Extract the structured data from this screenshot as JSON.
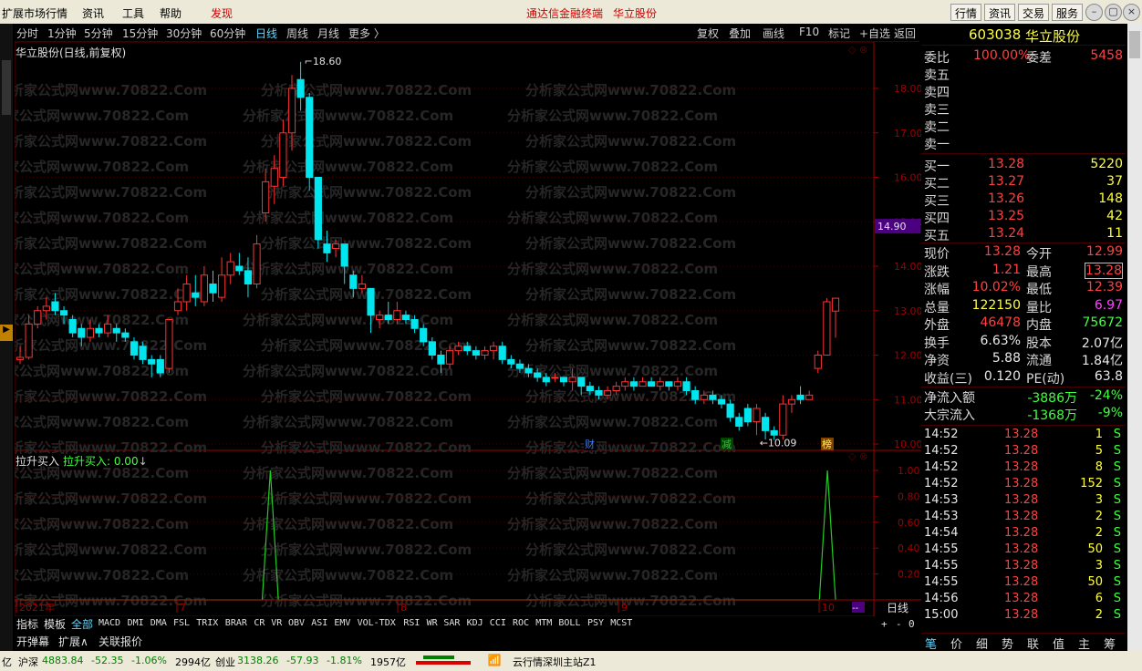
{
  "menubar": {
    "items": [
      "扩展市场行情",
      "资讯",
      "工具",
      "帮助"
    ],
    "discover": "发现",
    "center_title": "通达信金融终端",
    "center_stock": "华立股份",
    "sys_buttons": [
      "行情",
      "资讯",
      "交易",
      "服务"
    ],
    "win_buttons": [
      "–",
      "▢",
      "×"
    ]
  },
  "toolbar": {
    "left": [
      "分时",
      "1分钟",
      "5分钟",
      "15分钟",
      "30分钟",
      "60分钟",
      "日线",
      "周线",
      "月线",
      "更多 〉"
    ],
    "active": "日线",
    "right": [
      "复权",
      "叠加",
      "画线",
      "F10",
      "标记",
      "+自选",
      "返回"
    ]
  },
  "chart": {
    "title": "华立股份(日线,前复权)",
    "max_label": "18.60",
    "min_label": "10.09",
    "current_price_tag": "14.90",
    "y_labels": [
      "18.00",
      "17.00",
      "16.00",
      "15.00",
      "14.00",
      "13.00",
      "12.00",
      "11.00",
      "10.00"
    ],
    "events": [
      {
        "label": "财",
        "color": "#3a7dff",
        "bg": "#000000"
      },
      {
        "label": "减",
        "color": "#40c040",
        "bg": "#004000"
      },
      {
        "label": "榜",
        "color": "#ffff40",
        "bg": "#804000"
      }
    ],
    "date_labels": [
      "2021年",
      "7",
      "8",
      "9",
      "10"
    ],
    "period_label": "日线",
    "watermark": "分析家公式网www.70822.Com"
  },
  "indicator": {
    "name": "拉升买入",
    "value_label": "拉升买入: 0.00",
    "arrow": "↓",
    "y_labels": [
      "1.00",
      "0.80",
      "0.60",
      "0.40",
      "0.20"
    ]
  },
  "chart_data": [
    {
      "type": "candlestick",
      "title": "华立股份(日线,前复权)",
      "ylim": [
        10.0,
        18.6
      ],
      "max": 18.6,
      "min": 10.09
    },
    {
      "type": "line",
      "title": "拉升买入",
      "series": [
        {
          "name": "拉升买入",
          "values": [
            0,
            0,
            0,
            0,
            0,
            0,
            0,
            0,
            0,
            0,
            0,
            0,
            0,
            0,
            0,
            0,
            0,
            0,
            0,
            0,
            0,
            0,
            0,
            0,
            0,
            0,
            0,
            0,
            0,
            0,
            0,
            1,
            0,
            0,
            0,
            0,
            0,
            0,
            0,
            0,
            0,
            0,
            0,
            0,
            0,
            0,
            0,
            0,
            0,
            0,
            0,
            0,
            0,
            0,
            0,
            0,
            0,
            0,
            0,
            0,
            0,
            0,
            0,
            0,
            0,
            0,
            0,
            0,
            0,
            0,
            0,
            0,
            0,
            0,
            0,
            0,
            0,
            0,
            0,
            0,
            0,
            0,
            0,
            0,
            0,
            0,
            0,
            0,
            0,
            0,
            0,
            0,
            0,
            0,
            0,
            0,
            0,
            0,
            0,
            0,
            1,
            0
          ]
        }
      ],
      "ylim": [
        0,
        1
      ]
    }
  ],
  "quote": {
    "code": "603038",
    "name": "华立股份",
    "weibi_label": "委比",
    "weibi": "100.00%",
    "weicha_label": "委差",
    "weicha": "5458",
    "sells": [
      {
        "label": "卖五"
      },
      {
        "label": "卖四"
      },
      {
        "label": "卖三"
      },
      {
        "label": "卖二"
      },
      {
        "label": "卖一"
      }
    ],
    "buys": [
      {
        "label": "买一",
        "price": "13.28",
        "vol": "5220"
      },
      {
        "label": "买二",
        "price": "13.27",
        "vol": "37"
      },
      {
        "label": "买三",
        "price": "13.26",
        "vol": "148"
      },
      {
        "label": "买四",
        "price": "13.25",
        "vol": "42"
      },
      {
        "label": "买五",
        "price": "13.24",
        "vol": "11"
      }
    ],
    "stats": [
      {
        "l1": "现价",
        "v1": "13.28",
        "c1": "pr",
        "l2": "今开",
        "v2": "12.99",
        "c2": "pr"
      },
      {
        "l1": "涨跌",
        "v1": "1.21",
        "c1": "pr",
        "l2": "最高",
        "v2": "13.28",
        "c2": "pr"
      },
      {
        "l1": "涨幅",
        "v1": "10.02%",
        "c1": "pr",
        "l2": "最低",
        "v2": "12.39",
        "c2": "pr"
      },
      {
        "l1": "总量",
        "v1": "122150",
        "c1": "yl",
        "l2": "量比",
        "v2": "6.97",
        "c2": "mg"
      },
      {
        "l1": "外盘",
        "v1": "46478",
        "c1": "pr",
        "l2": "内盘",
        "v2": "75672",
        "c2": "gn"
      },
      {
        "l1": "换手",
        "v1": "6.63%",
        "c1": "wt",
        "l2": "股本",
        "v2": "2.07亿",
        "c2": "wt"
      },
      {
        "l1": "净资",
        "v1": "5.88",
        "c1": "wt",
        "l2": "流通",
        "v2": "1.84亿",
        "c2": "wt"
      },
      {
        "l1": "收益(三)",
        "v1": "0.120",
        "c1": "wt",
        "l2": "PE(动)",
        "v2": "63.8",
        "c2": "wt"
      }
    ],
    "flow": [
      {
        "label": "净流入额",
        "val": "-3886万",
        "pct": "-24%"
      },
      {
        "label": "大宗流入",
        "val": "-1368万",
        "pct": "-9%"
      }
    ],
    "ticks": [
      {
        "t": "14:52",
        "p": "13.28",
        "v": "1",
        "s": "S"
      },
      {
        "t": "14:52",
        "p": "13.28",
        "v": "5",
        "s": "S"
      },
      {
        "t": "14:52",
        "p": "13.28",
        "v": "8",
        "s": "S"
      },
      {
        "t": "14:52",
        "p": "13.28",
        "v": "152",
        "s": "S"
      },
      {
        "t": "14:53",
        "p": "13.28",
        "v": "3",
        "s": "S"
      },
      {
        "t": "14:53",
        "p": "13.28",
        "v": "2",
        "s": "S"
      },
      {
        "t": "14:54",
        "p": "13.28",
        "v": "2",
        "s": "S"
      },
      {
        "t": "14:55",
        "p": "13.28",
        "v": "50",
        "s": "S"
      },
      {
        "t": "14:55",
        "p": "13.28",
        "v": "3",
        "s": "S"
      },
      {
        "t": "14:55",
        "p": "13.28",
        "v": "50",
        "s": "S"
      },
      {
        "t": "14:56",
        "p": "13.28",
        "v": "6",
        "s": "S"
      },
      {
        "t": "15:00",
        "p": "13.28",
        "v": "2",
        "s": "S"
      }
    ],
    "bottom_tabs": [
      "笔",
      "价",
      "细",
      "势",
      "联",
      "值",
      "主",
      "筹"
    ]
  },
  "tabs": {
    "items": [
      "指标",
      "模板",
      "全部",
      "MACD",
      "DMI",
      "DMA",
      "FSL",
      "TRIX",
      "BRAR",
      "CR",
      "VR",
      "OBV",
      "ASI",
      "EMV",
      "VOL-TDX",
      "RSI",
      "WR",
      "SAR",
      "KDJ",
      "CCI",
      "ROC",
      "MTM",
      "BOLL",
      "PSY",
      "MCST"
    ],
    "sub": [
      "开弹幕",
      "扩展∧",
      "关联报价"
    ],
    "ctrl": [
      "+",
      "-",
      "0"
    ]
  },
  "status": {
    "hs_label": "沪深",
    "hs_val": "4883.84",
    "hs_chg": "-52.35",
    "hs_pct": "-1.06%",
    "hs_amt": "2994亿",
    "cy_label": "创业",
    "cy_val": "3138.26",
    "cy_chg": "-57.93",
    "cy_pct": "-1.81%",
    "cy_amt": "1957亿",
    "left_amt": "亿",
    "server": "云行情深圳主站Z1"
  }
}
